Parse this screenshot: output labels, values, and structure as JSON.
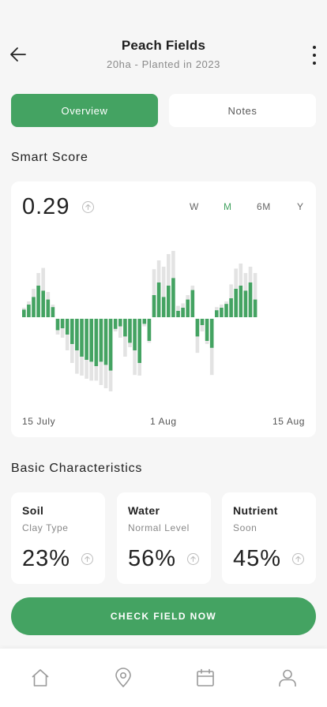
{
  "header": {
    "title": "Peach Fields",
    "subtitle": "20ha - Planted in 2023",
    "back_icon": "arrow-left-icon",
    "more_icon": "more-vertical-icon"
  },
  "tabs": [
    {
      "label": "Overview",
      "active": true
    },
    {
      "label": "Notes",
      "active": false
    }
  ],
  "smart_score": {
    "section_title": "Smart Score",
    "value": "0.29",
    "info_icon": "arrow-up-circle-icon",
    "periods": [
      {
        "label": "W",
        "active": false
      },
      {
        "label": "M",
        "active": true
      },
      {
        "label": "6M",
        "active": false
      },
      {
        "label": "Y",
        "active": false
      }
    ]
  },
  "chart_data": {
    "type": "bar",
    "x_labels": [
      "15 July",
      "1 Aug",
      "15 Aug"
    ],
    "colors": {
      "primary": "#44a362",
      "secondary": "#e3e3e3"
    },
    "series": [
      {
        "values": [
          1.2,
          2,
          3.2,
          5,
          4.2,
          2.8,
          1.6,
          -1.8,
          -1.5,
          -2.5,
          -4,
          -5,
          -6,
          -6.5,
          -6.8,
          -7.5,
          -6.8,
          -7.3,
          -8.2,
          -1.6,
          -1.2,
          -2.8,
          -3.8,
          -5,
          -7,
          -0.8,
          -3.5,
          3.5,
          5.5,
          3.2,
          5,
          6.2,
          1,
          1.5,
          2.8,
          4.3,
          -2.8,
          -1,
          -3.5,
          -4.6,
          1.1,
          1.5,
          2.1,
          3,
          4.5,
          5,
          4.2,
          5.5,
          2.8
        ]
      },
      {
        "values": [
          1.5,
          2.5,
          4.5,
          7,
          7.8,
          4,
          2,
          -2.5,
          -3,
          -5,
          -7,
          -8.7,
          -9,
          -9.5,
          -9.8,
          -9.8,
          -10.5,
          -11,
          -11.5,
          -2,
          -3,
          -6,
          -4.5,
          -8.9,
          -9,
          -1.2,
          -3.8,
          7.6,
          9,
          8,
          10,
          10.5,
          1.8,
          2.2,
          3.5,
          5,
          -5.4,
          -2,
          -4,
          -8.9,
          1.6,
          2,
          2.5,
          5.2,
          7.7,
          8.5,
          7,
          8,
          7
        ]
      }
    ],
    "grid": false,
    "legend": "none"
  },
  "characteristics": {
    "section_title": "Basic Characteristics",
    "cards": [
      {
        "name": "Soil",
        "sub": "Clay Type",
        "value": "23%"
      },
      {
        "name": "Water",
        "sub": "Normal Level",
        "value": "56%"
      },
      {
        "name": "Nutrient",
        "sub": "Soon",
        "value": "45%"
      }
    ]
  },
  "cta": {
    "label": "CHECK FIELD NOW"
  },
  "bottom_nav": [
    {
      "icon": "home-icon"
    },
    {
      "icon": "map-pin-icon"
    },
    {
      "icon": "calendar-icon"
    },
    {
      "icon": "user-icon"
    }
  ]
}
